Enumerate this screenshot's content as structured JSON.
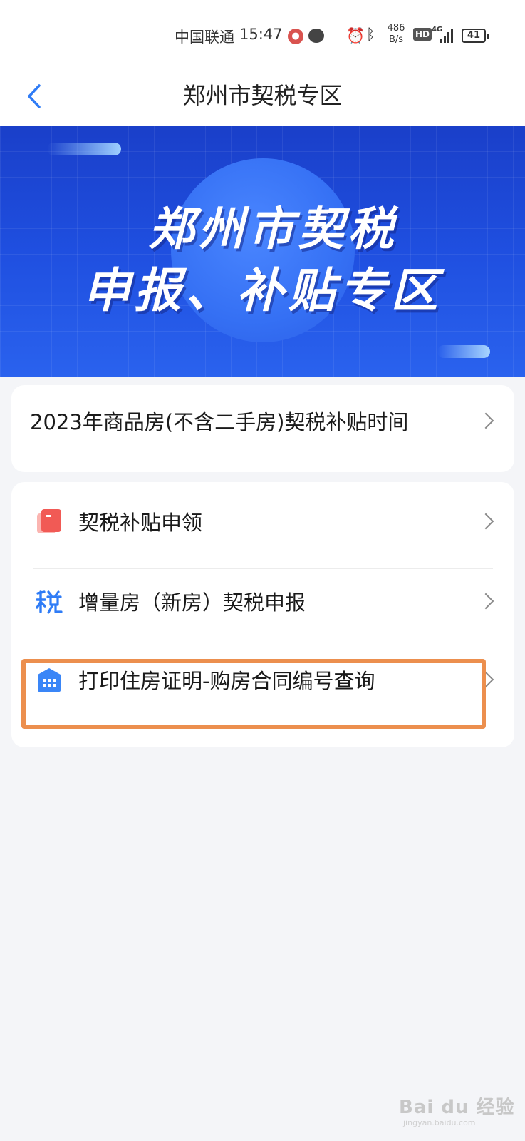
{
  "status_bar": {
    "carrier": "中国联通",
    "time": "15:47",
    "speed_value": "486",
    "speed_unit": "B/s",
    "hd": "HD",
    "network": "4G",
    "battery": "41"
  },
  "header": {
    "title": "郑州市契税专区"
  },
  "banner": {
    "line1": "郑州市契税",
    "line2": "申报、补贴专区"
  },
  "time_card": {
    "label": "2023年商品房(不含二手房)契税补贴时间"
  },
  "menu": {
    "items": [
      {
        "label": "契税补贴申领",
        "icon": "subsidy-icon"
      },
      {
        "label": "增量房（新房）契税申报",
        "icon": "tax-icon"
      },
      {
        "label": "打印住房证明-购房合同编号查询",
        "icon": "building-icon"
      }
    ]
  },
  "watermark": {
    "text": "Bai du 经验",
    "sub": "jingyan.baidu.com"
  },
  "colors": {
    "accent": "#2f7cf6",
    "highlight": "#ec8f4e",
    "banner": "#1f4fe0",
    "subsidy_icon": "#f15a55"
  }
}
